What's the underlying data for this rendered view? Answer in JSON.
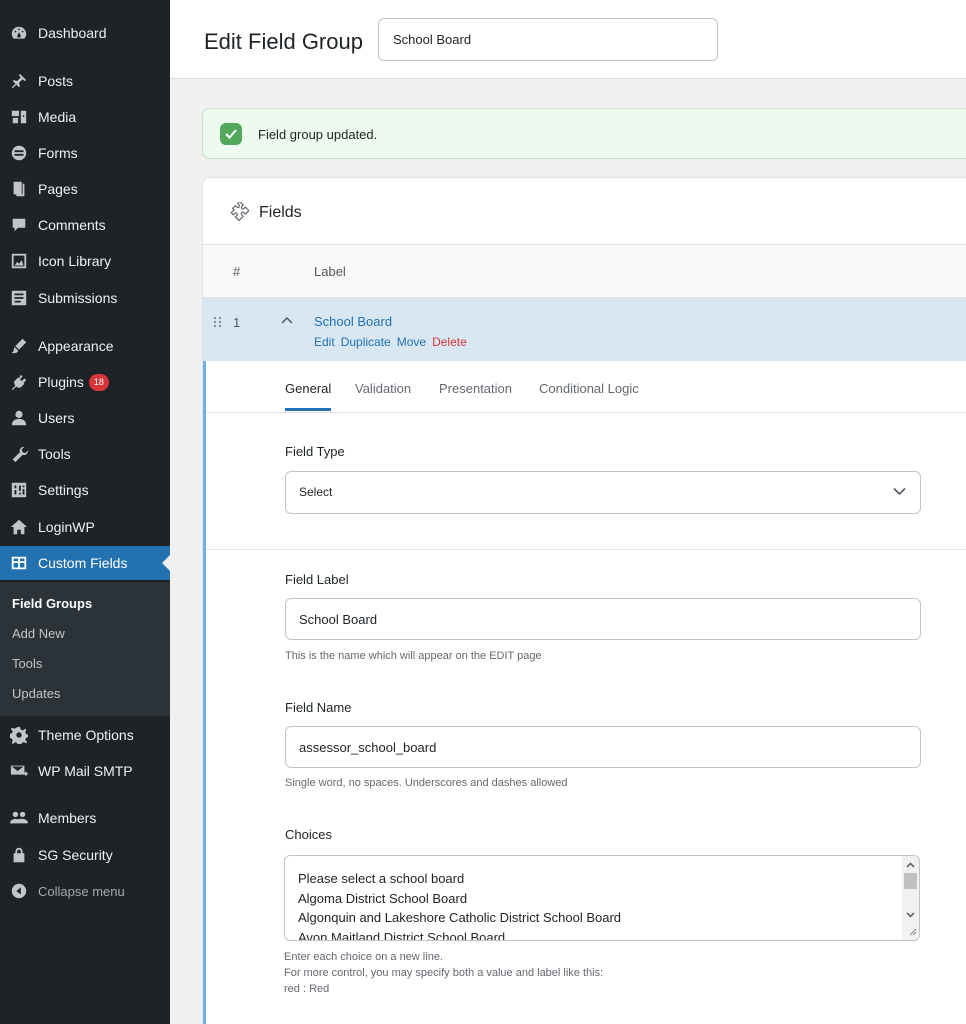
{
  "sidebar": {
    "items": [
      {
        "label": "Dashboard",
        "icon": "dashboard-icon"
      },
      {
        "label": "Posts",
        "icon": "pin-icon"
      },
      {
        "label": "Media",
        "icon": "media-icon"
      },
      {
        "label": "Forms",
        "icon": "forms-icon"
      },
      {
        "label": "Pages",
        "icon": "pages-icon"
      },
      {
        "label": "Comments",
        "icon": "comment-icon"
      },
      {
        "label": "Icon Library",
        "icon": "image-icon"
      },
      {
        "label": "Submissions",
        "icon": "list-icon"
      },
      {
        "label": "Appearance",
        "icon": "brush-icon"
      },
      {
        "label": "Plugins",
        "icon": "plugin-icon",
        "badge": "18"
      },
      {
        "label": "Users",
        "icon": "user-icon"
      },
      {
        "label": "Tools",
        "icon": "wrench-icon"
      },
      {
        "label": "Settings",
        "icon": "settings-icon"
      },
      {
        "label": "LoginWP",
        "icon": "home-icon"
      },
      {
        "label": "Custom Fields",
        "icon": "table-icon"
      },
      {
        "label": "Theme Options",
        "icon": "gear-icon"
      },
      {
        "label": "WP Mail SMTP",
        "icon": "mail-icon"
      },
      {
        "label": "Members",
        "icon": "members-icon"
      },
      {
        "label": "SG Security",
        "icon": "lock-icon"
      },
      {
        "label": "Collapse menu",
        "icon": "collapse-icon"
      }
    ],
    "submenu": [
      "Field Groups",
      "Add New",
      "Tools",
      "Updates"
    ]
  },
  "header": {
    "title": "Edit Field Group",
    "group_title_value": "School Board"
  },
  "notice": {
    "text": "Field group updated."
  },
  "fields_panel": {
    "title": "Fields",
    "columns": {
      "number": "#",
      "label": "Label"
    },
    "row": {
      "number": "1",
      "label": "School Board",
      "actions": [
        "Edit",
        "Duplicate",
        "Move",
        "Delete"
      ]
    },
    "tabs": [
      "General",
      "Validation",
      "Presentation",
      "Conditional Logic"
    ],
    "field_type": {
      "label": "Field Type",
      "value": "Select"
    },
    "field_label": {
      "label": "Field Label",
      "value": "School Board",
      "help": "This is the name which will appear on the EDIT page"
    },
    "field_name": {
      "label": "Field Name",
      "value": "assessor_school_board",
      "help": "Single word, no spaces. Underscores and dashes allowed"
    },
    "choices": {
      "label": "Choices",
      "lines": [
        "Please select a school board",
        "Algoma District School Board",
        "Algonquin and Lakeshore Catholic District School Board",
        "Avon Maitland District School Board"
      ],
      "help": [
        "Enter each choice on a new line.",
        "For more control, you may specify both a value and label like this:",
        "red : Red"
      ]
    }
  },
  "colors": {
    "sidebar_bg": "#1d2327",
    "accent": "#2271b1",
    "delete": "#d63638",
    "success": "#52a85a"
  }
}
